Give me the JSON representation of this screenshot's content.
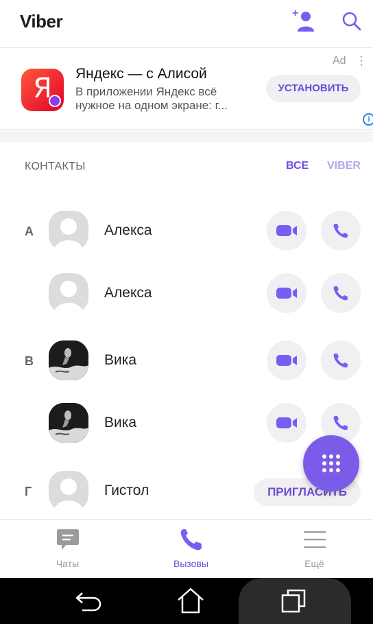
{
  "app": {
    "title": "Viber"
  },
  "ad": {
    "title": "Яндекс — с Алисой",
    "description": "В приложении Яндекс всё нужное на одном экране: г...",
    "label": "Ad",
    "menu": "⋮",
    "install_label": "УСТАНОВИТЬ",
    "logo_letter": "Я",
    "info": "i"
  },
  "contacts_section": {
    "title": "КОНТАКТЫ",
    "filters": {
      "all": "ВСЕ",
      "viber": "VIBER"
    },
    "items": [
      {
        "letter": "А",
        "name": "Алекса",
        "avatar": "placeholder",
        "actions": [
          "video",
          "call"
        ]
      },
      {
        "letter": "",
        "name": "Алекса",
        "avatar": "placeholder",
        "actions": [
          "video",
          "call"
        ]
      },
      {
        "letter": "В",
        "name": "Вика",
        "avatar": "photo",
        "actions": [
          "video",
          "call"
        ]
      },
      {
        "letter": "",
        "name": "Вика",
        "avatar": "photo",
        "actions": [
          "video",
          "call"
        ]
      },
      {
        "letter": "Г",
        "name": "Гистол",
        "avatar": "placeholder",
        "actions": [
          "invite"
        ],
        "invite_label": "ПРИГЛАСИТЬ"
      }
    ]
  },
  "bottom_nav": {
    "items": [
      {
        "label": "Чаты",
        "icon": "chat-icon",
        "active": false
      },
      {
        "label": "Вызовы",
        "icon": "phone-icon",
        "active": true
      },
      {
        "label": "Ещё",
        "icon": "menu-icon",
        "active": false
      }
    ]
  },
  "colors": {
    "accent": "#7360f2",
    "accent_light": "#b6a6ef",
    "muted": "#9b9b9b"
  }
}
